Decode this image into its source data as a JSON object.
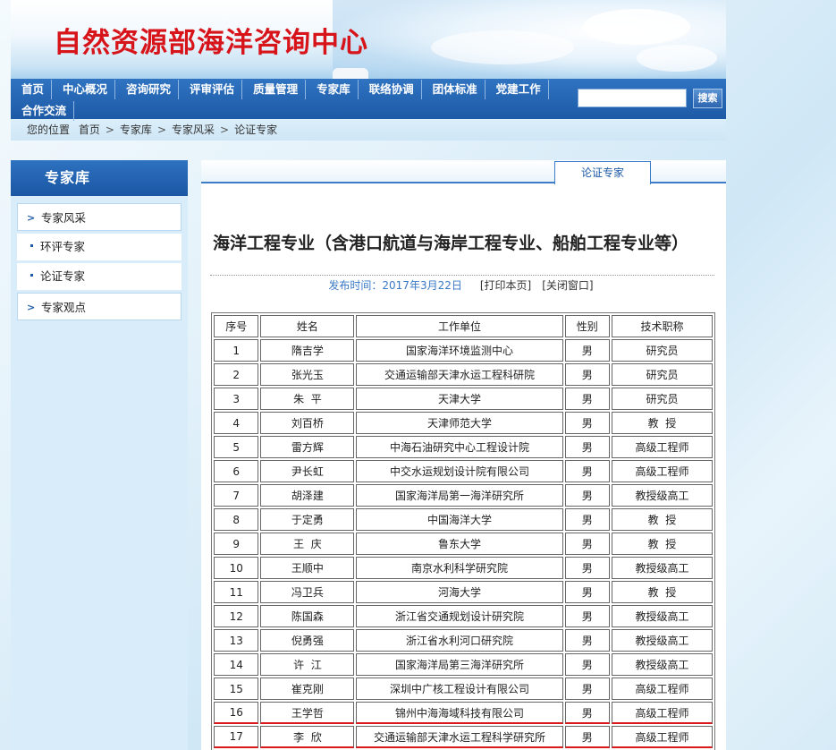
{
  "site": {
    "title": "自然资源部海洋咨询中心"
  },
  "nav": {
    "items": [
      "首页",
      "中心概况",
      "咨询研究",
      "评审评估",
      "质量管理",
      "专家库",
      "联络协调",
      "团体标准",
      "党建工作",
      "合作交流"
    ],
    "search_value": "",
    "search_button": "搜索"
  },
  "breadcrumb": {
    "prefix": "您的位置",
    "items": [
      "首页",
      "专家库",
      "专家风采",
      "论证专家"
    ],
    "separator": ">"
  },
  "sidebar": {
    "title": "专家库",
    "items": [
      {
        "label": "专家风采",
        "type": "main"
      },
      {
        "label": "环评专家",
        "type": "sub"
      },
      {
        "label": "论证专家",
        "type": "sub"
      },
      {
        "label": "专家观点",
        "type": "main"
      }
    ]
  },
  "content": {
    "tab": "论证专家",
    "title": "海洋工程专业（含港口航道与海岸工程专业、船舶工程专业等）",
    "publish_label": "发布时间：",
    "publish_date": "2017年3月22日",
    "print_link": "[打印本页]",
    "close_link": "[关闭窗口]"
  },
  "table": {
    "headers": [
      "序号",
      "姓名",
      "工作单位",
      "性别",
      "技术职称"
    ],
    "rows": [
      [
        "1",
        "隋吉学",
        "国家海洋环境监测中心",
        "男",
        "研究员"
      ],
      [
        "2",
        "张光玉",
        "交通运输部天津水运工程科研院",
        "男",
        "研究员"
      ],
      [
        "3",
        "朱  平",
        "天津大学",
        "男",
        "研究员"
      ],
      [
        "4",
        "刘百桥",
        "天津师范大学",
        "男",
        "教  授"
      ],
      [
        "5",
        "雷方辉",
        "中海石油研究中心工程设计院",
        "男",
        "高级工程师"
      ],
      [
        "6",
        "尹长虹",
        "中交水运规划设计院有限公司",
        "男",
        "高级工程师"
      ],
      [
        "7",
        "胡泽建",
        "国家海洋局第一海洋研究所",
        "男",
        "教授级高工"
      ],
      [
        "8",
        "于定勇",
        "中国海洋大学",
        "男",
        "教  授"
      ],
      [
        "9",
        "王  庆",
        "鲁东大学",
        "男",
        "教  授"
      ],
      [
        "10",
        "王顺中",
        "南京水利科学研究院",
        "男",
        "教授级高工"
      ],
      [
        "11",
        "冯卫兵",
        "河海大学",
        "男",
        "教  授"
      ],
      [
        "12",
        "陈国森",
        "浙江省交通规划设计研究院",
        "男",
        "教授级高工"
      ],
      [
        "13",
        "倪勇强",
        "浙江省水利河口研究院",
        "男",
        "教授级高工"
      ],
      [
        "14",
        "许  江",
        "国家海洋局第三海洋研究所",
        "男",
        "教授级高工"
      ],
      [
        "15",
        "崔克刚",
        "深圳中广核工程设计有限公司",
        "男",
        "高级工程师"
      ],
      [
        "16",
        "王学哲",
        "锦州中海海域科技有限公司",
        "男",
        "高级工程师"
      ],
      [
        "17",
        "李  欣",
        "交通运输部天津水运工程科学研究所",
        "男",
        "高级工程师"
      ]
    ]
  },
  "colors": {
    "title_red": "#d8141b",
    "nav_blue": "#1d5aa6",
    "link_blue": "#3a79c6",
    "underline_red": "#d81a1a"
  }
}
